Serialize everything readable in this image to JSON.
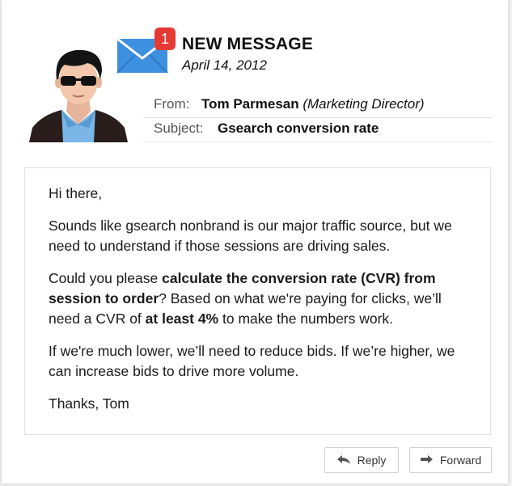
{
  "header": {
    "title": "NEW MESSAGE",
    "badge_count": "1",
    "date": "April 14, 2012"
  },
  "from": {
    "label": "From:",
    "name": "Tom Parmesan",
    "role": "(Marketing Director)"
  },
  "subject": {
    "label": "Subject:",
    "value": "Gsearch conversion rate"
  },
  "body": {
    "greeting": "Hi there,",
    "p1": "Sounds like gsearch nonbrand is our major traffic source, but we need to understand if those sessions are driving sales.",
    "p2_a": "Could you please ",
    "p2_b": "calculate the conversion rate (CVR) from session to order",
    "p2_c": "? Based on what we're paying for clicks, we’ll need a CVR of ",
    "p2_d": "at least 4%",
    "p2_e": " to make the numbers work.",
    "p3": "If we're much lower, we’ll need to reduce bids. If we’re higher, we can increase bids to drive more volume.",
    "signoff": "Thanks, Tom"
  },
  "actions": {
    "reply_label": "Reply",
    "reply_icon": "reply-arrow-icon",
    "forward_label": "Forward",
    "forward_icon": "forward-arrow-icon"
  },
  "colors": {
    "badge": "#e53935",
    "mail_icon": "#3d8fe0"
  }
}
